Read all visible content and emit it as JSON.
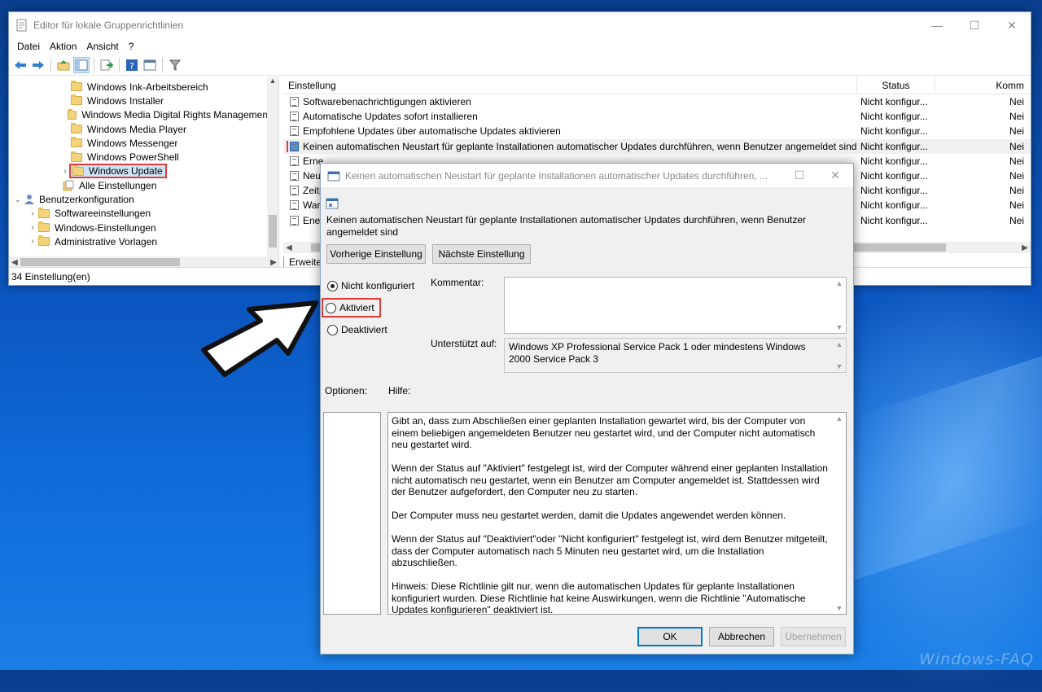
{
  "window": {
    "title": "Editor für lokale Gruppenrichtlinien",
    "minimize": "—",
    "maximize": "☐",
    "close": "✕"
  },
  "menu": [
    "Datei",
    "Aktion",
    "Ansicht",
    "?"
  ],
  "tree": {
    "items": [
      {
        "label": "Windows Ink-Arbeitsbereich"
      },
      {
        "label": "Windows Installer"
      },
      {
        "label": "Windows Media Digital Rights Managemen"
      },
      {
        "label": "Windows Media Player"
      },
      {
        "label": "Windows Messenger"
      },
      {
        "label": "Windows PowerShell"
      },
      {
        "label": "Windows Update"
      },
      {
        "label": "Alle Einstellungen"
      },
      {
        "label": "Benutzerkonfiguration"
      },
      {
        "label": "Softwareeinstellungen"
      },
      {
        "label": "Windows-Einstellungen"
      },
      {
        "label": "Administrative Vorlagen"
      }
    ]
  },
  "list": {
    "headers": {
      "setting": "Einstellung",
      "status": "Status",
      "comment": "Komm"
    },
    "rows": [
      {
        "name": "Softwarebenachrichtigungen aktivieren",
        "status": "Nicht konfigur...",
        "comment": "Nei"
      },
      {
        "name": "Automatische Updates sofort installieren",
        "status": "Nicht konfigur...",
        "comment": "Nei"
      },
      {
        "name": "Empfohlene Updates über automatische Updates aktivieren",
        "status": "Nicht konfigur...",
        "comment": "Nei"
      },
      {
        "name": "Keinen automatischen Neustart für geplante Installationen automatischer Updates durchführen, wenn Benutzer angemeldet sind",
        "status": "Nicht konfigur...",
        "comment": "Nei"
      },
      {
        "name": "Erne",
        "status": "Nicht konfigur...",
        "comment": "Nei"
      },
      {
        "name": "Neu",
        "status": "Nicht konfigur...",
        "comment": "Nei"
      },
      {
        "name": "Zeitp",
        "status": "Nicht konfigur...",
        "comment": "Nei"
      },
      {
        "name": "Warr",
        "status": "Nicht konfigur...",
        "comment": "Nei"
      },
      {
        "name": "Ener",
        "status": "Nicht konfigur...",
        "comment": "Nei"
      }
    ],
    "tab": "Erweite"
  },
  "statusbar": "34 Einstellung(en)",
  "dialog": {
    "title": "Keinen automatischen Neustart für geplante Installationen automatischer Updates durchführen, ...",
    "heading": "Keinen automatischen Neustart für geplante Installationen automatischer Updates durchführen, wenn Benutzer angemeldet sind",
    "prev_button": "Vorherige Einstellung",
    "next_button": "Nächste Einstellung",
    "radio_not_configured": "Nicht konfiguriert",
    "radio_enabled": "Aktiviert",
    "radio_disabled": "Deaktiviert",
    "selected_radio": "Nicht konfiguriert",
    "comment_label": "Kommentar:",
    "comment_value": "",
    "supported_label": "Unterstützt auf:",
    "supported_value": "Windows XP Professional Service Pack 1 oder mindestens Windows 2000 Service Pack 3",
    "options_label": "Optionen:",
    "help_label": "Hilfe:",
    "help_paragraphs": [
      "Gibt an, dass zum Abschließen einer geplanten Installation gewartet wird, bis der Computer von einem beliebigen angemeldeten Benutzer neu gestartet wird, und der Computer nicht automatisch neu gestartet wird.",
      "Wenn der Status auf \"Aktiviert\" festgelegt ist, wird der Computer während einer geplanten Installation nicht automatisch neu gestartet, wenn ein Benutzer am Computer angemeldet ist. Stattdessen wird der Benutzer aufgefordert, den Computer neu zu starten.",
      "Der Computer muss neu gestartet werden, damit die Updates angewendet werden können.",
      "Wenn der Status auf \"Deaktiviert\"oder \"Nicht konfiguriert\" festgelegt ist, wird dem Benutzer mitgeteilt, dass der Computer automatisch nach 5 Minuten neu gestartet wird, um die Installation abzuschließen.",
      "Hinweis: Diese Richtlinie gilt nur, wenn die automatischen Updates für geplante Installationen konfiguriert wurden. Diese Richtlinie hat keine Auswirkungen, wenn die Richtlinie \"Automatische Updates konfigurieren\" deaktiviert ist."
    ],
    "ok_button": "OK",
    "cancel_button": "Abbrechen",
    "apply_button": "Übernehmen"
  },
  "watermark": "Windows-FAQ",
  "colors": {
    "highlight_red": "#e23b3b",
    "accent_blue": "#0078d7",
    "desktop_blue": "#0b56c0"
  }
}
